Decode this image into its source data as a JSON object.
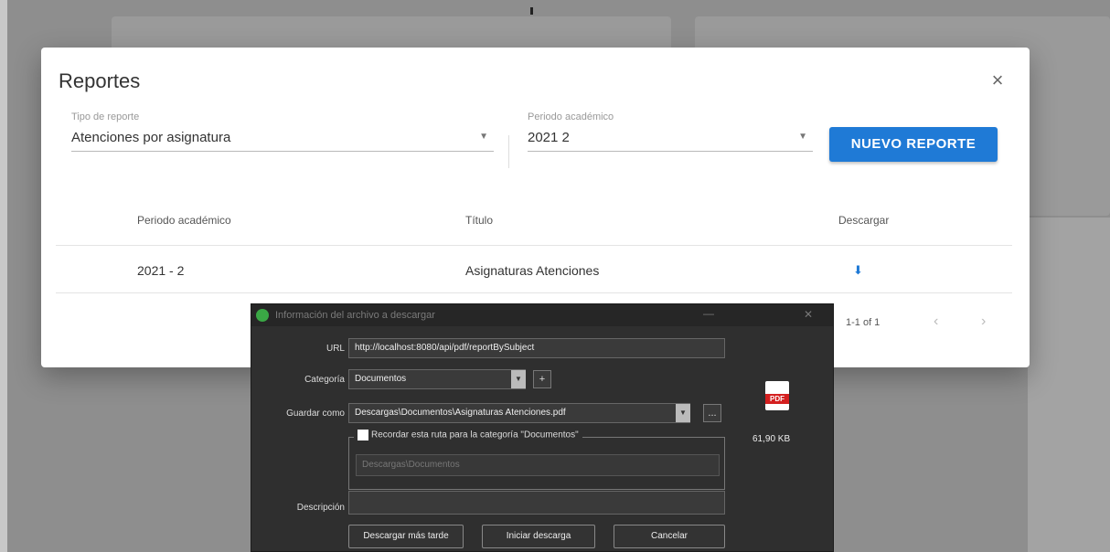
{
  "dialog": {
    "title": "Reportes",
    "close_label": "×",
    "fields": {
      "report_type": {
        "label": "Tipo de reporte",
        "value": "Atenciones por asignatura"
      },
      "period": {
        "label": "Periodo académico",
        "value": "2021 2"
      }
    },
    "new_report_label": "NUEVO REPORTE",
    "table": {
      "headers": [
        "Periodo académico",
        "Título",
        "Descargar"
      ],
      "rows": [
        {
          "period": "2021 - 2",
          "title": "Asignaturas Atenciones",
          "download_icon": "⬇"
        }
      ]
    },
    "pagination": {
      "range": "1-1 of 1",
      "prev": "‹",
      "next": "›"
    }
  },
  "download_window": {
    "title": "Información del archivo a descargar",
    "url_label": "URL",
    "url_value": "http://localhost:8080/api/pdf/reportBySubject",
    "category_label": "Categoría",
    "category_value": "Documentos",
    "add_category": "+",
    "save_as_label": "Guardar como",
    "save_as_value": "Descargas\\Documentos\\Asignaturas Atenciones.pdf",
    "browse": "...",
    "remember_label": "Recordar esta ruta para la categoría \"Documentos\"",
    "remember_path_placeholder": "Descargas\\Documentos",
    "description_label": "Descripción",
    "description_value": "",
    "file_size": "61,90 KB",
    "buttons": {
      "later": "Descargar más tarde",
      "start": "Iniciar descarga",
      "cancel": "Cancelar"
    },
    "minimize": "—",
    "close": "✕"
  }
}
